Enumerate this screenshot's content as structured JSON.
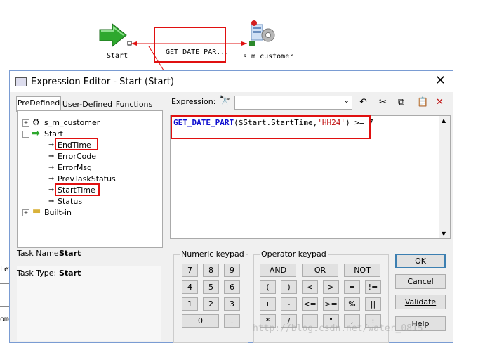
{
  "workflow": {
    "start_label": "Start",
    "link_label": "GET_DATE_PAR...",
    "session_label": "s_m_customer"
  },
  "dialog": {
    "title": "Expression Editor - Start (Start)",
    "tabs": [
      "PreDefined",
      "User-Defined",
      "Functions"
    ],
    "expression_label": "Expression:",
    "expression_text": {
      "func": "GET_DATE_PART",
      "arg": "($Start.StartTime,",
      "fmt": "'HH24'",
      "tail": ") >= 7"
    },
    "tree": {
      "session": "s_m_customer",
      "start": "Start",
      "children": [
        "EndTime",
        "ErrorCode",
        "ErrorMsg",
        "PrevTaskStatus",
        "StartTime",
        "Status"
      ],
      "builtin": "Built-in"
    },
    "task_name_label": "Task Name:",
    "task_name_value": "Start",
    "task_type_label": "Task Type:",
    "task_type_value": "Start",
    "numeric_keypad": {
      "title": "Numeric keypad",
      "keys": [
        "7",
        "8",
        "9",
        "4",
        "5",
        "6",
        "1",
        "2",
        "3",
        "0",
        "."
      ]
    },
    "operator_keypad": {
      "title": "Operator keypad",
      "row1": [
        "AND",
        "OR",
        "NOT"
      ],
      "row2": [
        "(",
        ")",
        "<",
        ">",
        "=",
        "!="
      ],
      "row3": [
        "+",
        "-",
        "<=",
        ">=",
        "%",
        "||"
      ],
      "row4": [
        "*",
        "/",
        "'",
        "\"",
        ",",
        ":"
      ]
    },
    "buttons": {
      "ok": "OK",
      "cancel": "Cancel",
      "validate": "Validate",
      "help": "Help"
    }
  },
  "background_fragments": [
    "Let",
    "ome"
  ],
  "watermark": "http://blog.csdn.net/water_0815"
}
